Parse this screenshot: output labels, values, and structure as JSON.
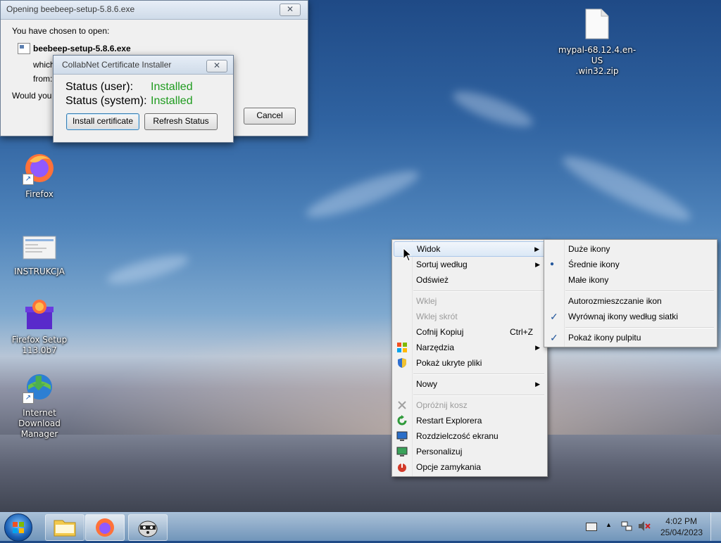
{
  "desktop": {
    "icons": [
      {
        "label": "Firefox"
      },
      {
        "label": "INSTRUKCJA"
      },
      {
        "label_line1": "Firefox Setup",
        "label_line2": "113.0b7"
      },
      {
        "label_line1": "Internet Download",
        "label_line2": "Manager"
      },
      {
        "label_line1": "mypal-68.12.4.en-US",
        "label_line2": ".win32.zip"
      }
    ]
  },
  "download_dialog": {
    "title": "Opening beebeep-setup-5.8.6.exe",
    "chosen_text": "You have chosen to open:",
    "filename": "beebeep-setup-5.8.6.exe",
    "which_text": "which",
    "from_text": "from:",
    "would_text": "Would you",
    "cancel_label": "Cancel",
    "close_glyph": "✕"
  },
  "cert_dialog": {
    "title": "CollabNet Certificate Installer",
    "status_user_label": "Status (user):",
    "status_user_value": "Installed",
    "status_system_label": "Status (system):",
    "status_system_value": "Installed",
    "install_label": "Install certificate",
    "refresh_label": "Refresh Status",
    "close_glyph": "✕",
    "status_color": "#1e9b1e"
  },
  "context_menu": {
    "items": [
      {
        "label": "Widok",
        "arrow": "▶"
      },
      {
        "label": "Sortuj według",
        "arrow": "▶"
      },
      {
        "label": "Odśwież"
      },
      {
        "label": "Wklej",
        "disabled": true
      },
      {
        "label": "Wklej skrót",
        "disabled": true
      },
      {
        "label": "Cofnij Kopiuj",
        "shortcut": "Ctrl+Z"
      },
      {
        "label": "Narzędzia",
        "arrow": "▶"
      },
      {
        "label": "Pokaż ukryte pliki"
      },
      {
        "label": "Nowy",
        "arrow": "▶"
      },
      {
        "label": "Opróżnij kosz",
        "disabled": true
      },
      {
        "label": "Restart Explorera"
      },
      {
        "label": "Rozdzielczość ekranu"
      },
      {
        "label": "Personalizuj"
      },
      {
        "label": "Opcje zamykania"
      }
    ]
  },
  "submenu": {
    "items": [
      {
        "label": "Duże ikony"
      },
      {
        "label": "Średnie ikony",
        "mark": "●"
      },
      {
        "label": "Małe ikony"
      },
      {
        "label": "Autorozmieszczanie ikon"
      },
      {
        "label": "Wyrównaj ikony według siatki",
        "mark": "✓"
      },
      {
        "label": "Pokaż ikony pulpitu",
        "mark": "✓"
      }
    ]
  },
  "taskbar": {
    "time": "4:02 PM",
    "date": "25/04/2023",
    "tray_up_arrow": "▲"
  }
}
